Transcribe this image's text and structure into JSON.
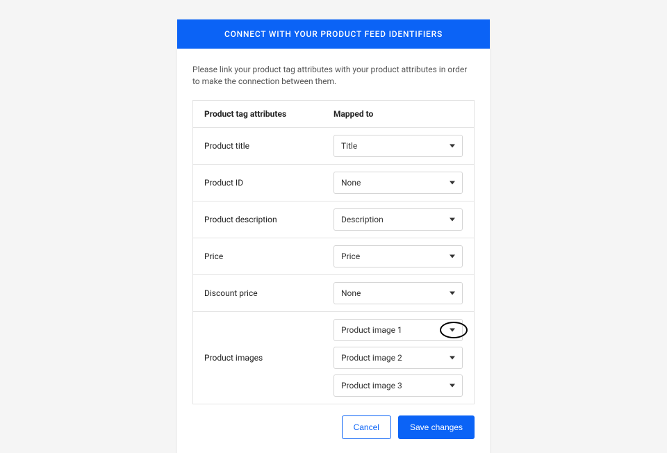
{
  "banner": {
    "title": "CONNECT WITH YOUR PRODUCT FEED IDENTIFIERS"
  },
  "intro": "Please link your product tag attributes with your product attributes in order to make the connection between them.",
  "headers": {
    "col1": "Product tag attributes",
    "col2": "Mapped to"
  },
  "rows": {
    "product_title": {
      "label": "Product title",
      "value": "Title"
    },
    "product_id": {
      "label": "Product ID",
      "value": "None"
    },
    "product_description": {
      "label": "Product description",
      "value": "Description"
    },
    "price": {
      "label": "Price",
      "value": "Price"
    },
    "discount_price": {
      "label": "Discount price",
      "value": "None"
    },
    "product_images": {
      "label": "Product images",
      "values": [
        "Product image 1",
        "Product image 2",
        "Product image 3"
      ]
    }
  },
  "actions": {
    "cancel": "Cancel",
    "save": "Save changes"
  }
}
